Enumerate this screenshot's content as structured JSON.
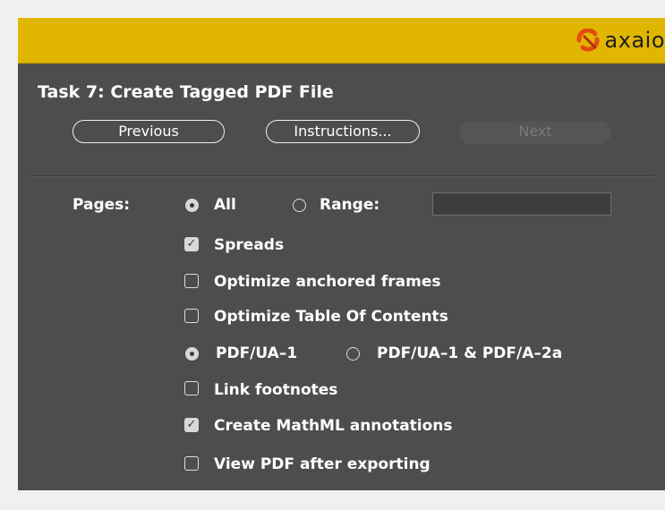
{
  "brand": {
    "logo_text": "axaio",
    "logo_icon": "axaio-logo-icon",
    "bar_color": "#e1b600"
  },
  "task": {
    "title": "Task 7: Create Tagged PDF File"
  },
  "nav": {
    "previous_label": "Previous",
    "instructions_label": "Instructions...",
    "next_label": "Next"
  },
  "pages": {
    "label": "Pages:",
    "all_label": "All",
    "all_selected": true,
    "range_label": "Range:",
    "range_value": "",
    "range_selected": false
  },
  "options": {
    "spreads": {
      "label": "Spreads",
      "checked": true
    },
    "optimize_anchored_frames": {
      "label": "Optimize anchored frames",
      "checked": false
    },
    "optimize_toc": {
      "label": "Optimize Table Of Contents",
      "checked": false
    },
    "link_footnotes": {
      "label": "Link footnotes",
      "checked": false
    },
    "create_mathml": {
      "label": "Create MathML annotations",
      "checked": true
    },
    "view_pdf": {
      "label": "View PDF after exporting",
      "checked": false
    }
  },
  "standard": {
    "ua1_label": "PDF/UA–1",
    "ua1_selected": true,
    "ua1_a2a_label": "PDF/UA–1 & PDF/A–2a",
    "ua1_a2a_selected": false
  }
}
